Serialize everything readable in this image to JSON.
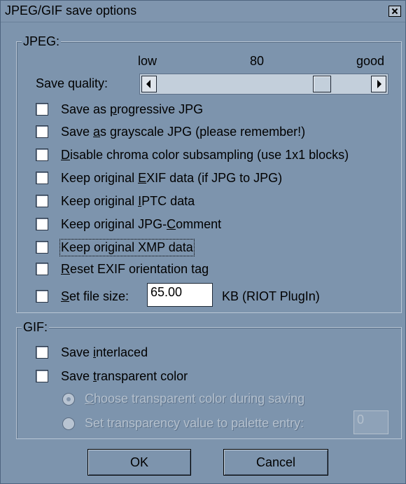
{
  "window": {
    "title": "JPEG/GIF save options"
  },
  "jpeg": {
    "legend": "JPEG:",
    "quality": {
      "label": "Save quality:",
      "low": "low",
      "value": "80",
      "good": "good",
      "level_percent": 80
    },
    "options": [
      {
        "pre": "Save as ",
        "key": "p",
        "post": "rogressive JPG",
        "checked": false
      },
      {
        "pre": "Save ",
        "key": "a",
        "post": "s grayscale JPG (please remember!)",
        "checked": false
      },
      {
        "pre": "",
        "key": "D",
        "post": "isable chroma color subsampling (use 1x1 blocks)",
        "checked": false
      },
      {
        "pre": "Keep original ",
        "key": "E",
        "post": "XIF data (if JPG to JPG)",
        "checked": false
      },
      {
        "pre": "Keep original ",
        "key": "I",
        "post": "PTC data",
        "checked": false
      },
      {
        "pre": "Keep original JPG-",
        "key": "C",
        "post": "omment",
        "checked": false
      },
      {
        "pre": "Keep original XMP data",
        "key": "",
        "post": "",
        "checked": false
      },
      {
        "pre": "",
        "key": "R",
        "post": "eset EXIF orientation tag",
        "checked": false
      }
    ],
    "filesize": {
      "pre": "",
      "key": "S",
      "post": "et file size:",
      "value": "65.00",
      "unit": "KB (RIOT PlugIn)",
      "checked": false
    }
  },
  "gif": {
    "legend": "GIF:",
    "interlaced": {
      "pre": "Save ",
      "key": "i",
      "post": "nterlaced",
      "checked": false
    },
    "transparent": {
      "pre": "Save ",
      "key": "t",
      "post": "ransparent color",
      "checked": false
    },
    "radio_choose": {
      "pre": "",
      "key": "C",
      "post": "hoose transparent color during saving",
      "selected": true
    },
    "radio_set": {
      "label": "Set transparency value to palette entry:",
      "value": "0",
      "selected": false
    }
  },
  "buttons": {
    "ok": "OK",
    "cancel": "Cancel"
  }
}
